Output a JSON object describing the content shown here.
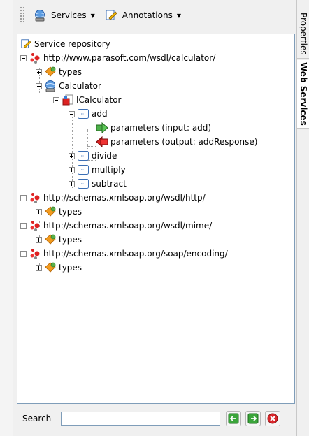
{
  "toolbar": {
    "services": {
      "label": "Services",
      "icon": "globe-icon"
    },
    "annotations": {
      "label": "Annotations",
      "icon": "note-pencil-icon"
    }
  },
  "tree": {
    "root": "Service repository",
    "nodes": {
      "calc_url": "http://www.parasoft.com/wsdl/calculator/",
      "calc_types": "types",
      "calculator": "Calculator",
      "icalculator": "ICalculator",
      "add": "add",
      "add_in": "parameters (input: add)",
      "add_out": "parameters (output: addResponse)",
      "divide": "divide",
      "multiply": "multiply",
      "subtract": "subtract",
      "http_url": "http://schemas.xmlsoap.org/wsdl/http/",
      "http_types": "types",
      "mime_url": "http://schemas.xmlsoap.org/wsdl/mime/",
      "mime_types": "types",
      "enc_url": "http://schemas.xmlsoap.org/soap/encoding/",
      "enc_types": "types"
    }
  },
  "search": {
    "label": "Search",
    "value": "",
    "placeholder": ""
  },
  "side_tabs": {
    "properties": "Properties",
    "web_services": "Web Services"
  },
  "colors": {
    "tree_border": "#7f9db9",
    "button_green": "#3aa53a",
    "button_red": "#d9262b"
  }
}
